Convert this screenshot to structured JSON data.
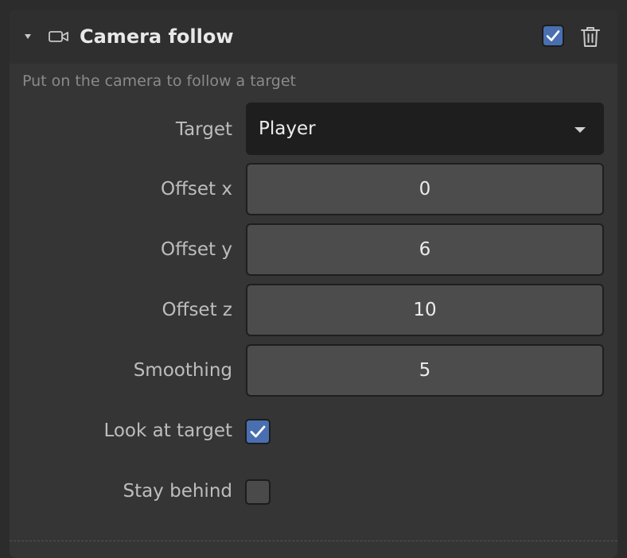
{
  "component": {
    "title": "Camera follow",
    "enabled": true,
    "description": "Put on the camera to follow a target",
    "icons": {
      "collapse": "collapse-triangle-icon",
      "type": "video-camera-icon",
      "delete": "trash-icon"
    }
  },
  "fields": {
    "target": {
      "label": "Target",
      "value": "Player"
    },
    "offset_x": {
      "label": "Offset x",
      "value": "0"
    },
    "offset_y": {
      "label": "Offset y",
      "value": "6"
    },
    "offset_z": {
      "label": "Offset z",
      "value": "10"
    },
    "smoothing": {
      "label": "Smoothing",
      "value": "5"
    },
    "look_at_target": {
      "label": "Look at target",
      "checked": true
    },
    "stay_behind": {
      "label": "Stay behind",
      "checked": false
    }
  },
  "colors": {
    "accent": "#4a6fb0",
    "panel": "#353535",
    "header": "#2f2f2f",
    "input": "#4c4c4c",
    "select": "#1e1e1e"
  }
}
